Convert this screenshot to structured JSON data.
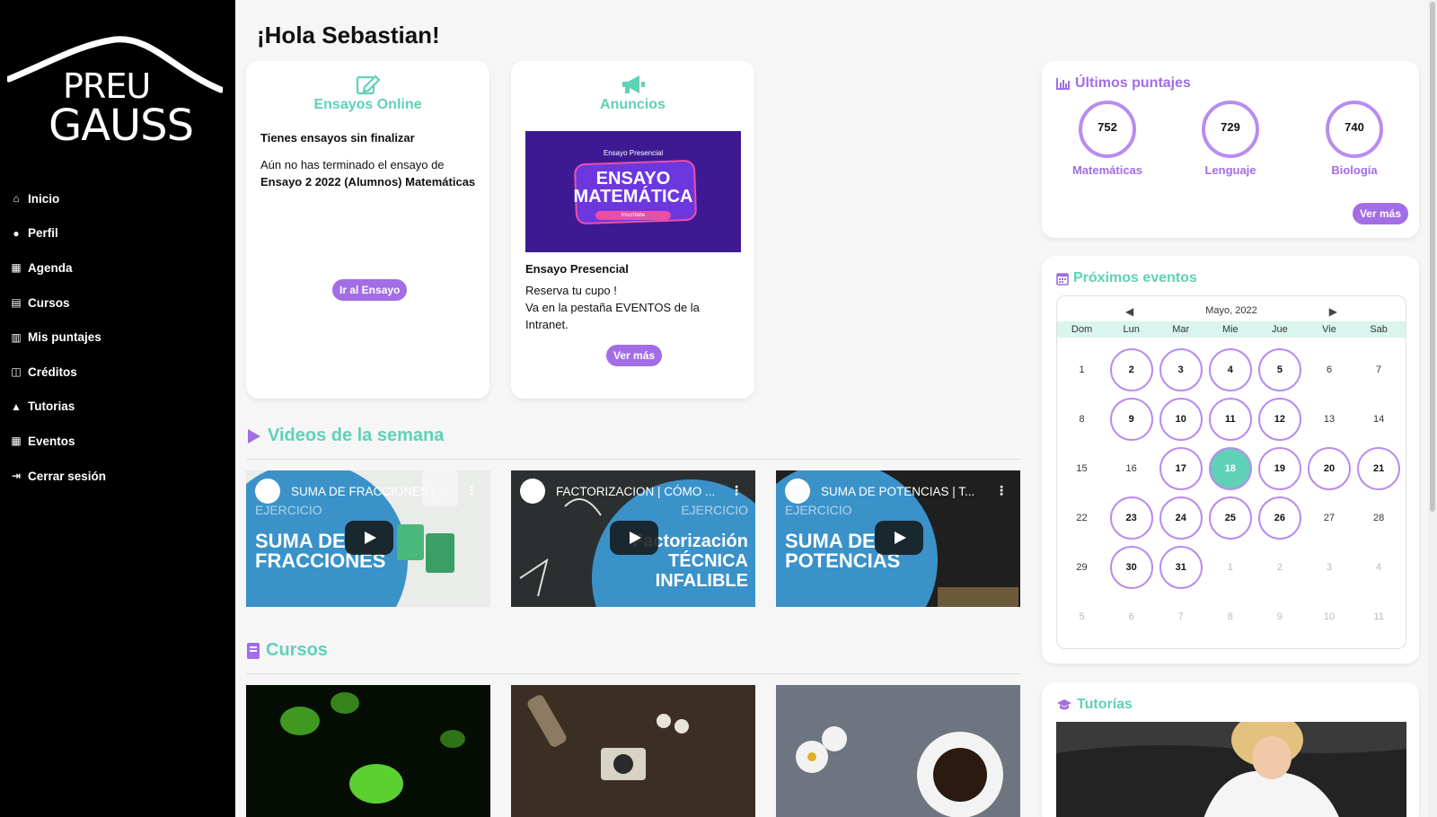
{
  "brand": {
    "line1": "PREU",
    "line2": "GAUSS"
  },
  "nav": [
    {
      "label": "Inicio",
      "icon": "home-icon"
    },
    {
      "label": "Perfil",
      "icon": "user-icon"
    },
    {
      "label": "Agenda",
      "icon": "calendar-icon"
    },
    {
      "label": "Cursos",
      "icon": "book-icon"
    },
    {
      "label": "Mis puntajes",
      "icon": "chart-icon"
    },
    {
      "label": "Créditos",
      "icon": "coins-icon"
    },
    {
      "label": "Tutorias",
      "icon": "graduation-cap-icon"
    },
    {
      "label": "Eventos",
      "icon": "calendar-grid-icon"
    },
    {
      "label": "Cerrar sesión",
      "icon": "logout-icon"
    }
  ],
  "greeting": "¡Hola Sebastian!",
  "ensayos": {
    "title": "Ensayos Online",
    "subtitle": "Tienes ensayos sin finalizar",
    "desc_prefix": "Aún no has terminado el ensayo de",
    "desc_bold": "Ensayo 2 2022 (Alumnos) Matemáticas",
    "button": "Ir al Ensayo"
  },
  "anuncios": {
    "title": "Anuncios",
    "image": {
      "small": "Ensayo Presencial",
      "line1": "ENSAYO",
      "line2": "MATEMÁTICA",
      "pill": "Inscríbete"
    },
    "item_title": "Ensayo Presencial",
    "item_line1": "Reserva tu cupo !",
    "item_line2": "Va en la pestaña EVENTOS de la Intranet.",
    "button": "Ver más"
  },
  "videos": {
    "title": "Videos de la semana",
    "items": [
      {
        "title": "SUMA DE FRACCIONES |...",
        "tag": "EJERCICIO",
        "t1": "SUMA DE",
        "t2": "FRACCIONES"
      },
      {
        "title": "FACTORIZACION | CÓMO ...",
        "tag": "EJERCICIO",
        "t1": "Factorización",
        "t2": "TÉCNICA",
        "t3": "INFALIBLE"
      },
      {
        "title": "SUMA DE POTENCIAS | T...",
        "tag": "EJERCICIO",
        "t1": "SUMA DE",
        "t2": "POTENCIAS"
      }
    ]
  },
  "cursos": {
    "title": "Cursos"
  },
  "scores": {
    "title": "Últimos puntajes",
    "items": [
      {
        "value": "752",
        "label": "Matemáticas"
      },
      {
        "value": "729",
        "label": "Lenguaje"
      },
      {
        "value": "740",
        "label": "Biología"
      }
    ],
    "button": "Ver más"
  },
  "events": {
    "title": "Próximos eventos",
    "month": "Mayo, 2022",
    "dow": [
      "Dom",
      "Lun",
      "Mar",
      "Mie",
      "Jue",
      "Vie",
      "Sab"
    ],
    "weeks": [
      [
        [
          "1",
          ""
        ],
        [
          "2",
          "e"
        ],
        [
          "3",
          "e"
        ],
        [
          "4",
          "e"
        ],
        [
          "5",
          "e"
        ],
        [
          "6",
          ""
        ],
        [
          "7",
          ""
        ]
      ],
      [
        [
          "8",
          ""
        ],
        [
          "9",
          "e"
        ],
        [
          "10",
          "e"
        ],
        [
          "11",
          "e"
        ],
        [
          "12",
          "e"
        ],
        [
          "13",
          ""
        ],
        [
          "14",
          ""
        ]
      ],
      [
        [
          "15",
          ""
        ],
        [
          "16",
          ""
        ],
        [
          "17",
          "e"
        ],
        [
          "18",
          "t"
        ],
        [
          "19",
          "e"
        ],
        [
          "20",
          "e"
        ],
        [
          "21",
          "e"
        ]
      ],
      [
        [
          "22",
          ""
        ],
        [
          "23",
          "e"
        ],
        [
          "24",
          "e"
        ],
        [
          "25",
          "e"
        ],
        [
          "26",
          "e"
        ],
        [
          "27",
          ""
        ],
        [
          "28",
          ""
        ]
      ],
      [
        [
          "29",
          ""
        ],
        [
          "30",
          "e"
        ],
        [
          "31",
          "e"
        ],
        [
          "1",
          "m"
        ],
        [
          "2",
          "m"
        ],
        [
          "3",
          "m"
        ],
        [
          "4",
          "m"
        ]
      ],
      [
        [
          "5",
          "m"
        ],
        [
          "6",
          "m"
        ],
        [
          "7",
          "m"
        ],
        [
          "8",
          "m"
        ],
        [
          "9",
          "m"
        ],
        [
          "10",
          "m"
        ],
        [
          "11",
          "m"
        ]
      ]
    ]
  },
  "tutorias": {
    "title": "Tutorías"
  },
  "colors": {
    "accent_teal": "#5fd1b6",
    "accent_purple": "#a26de6",
    "sidebar": "#000000"
  }
}
